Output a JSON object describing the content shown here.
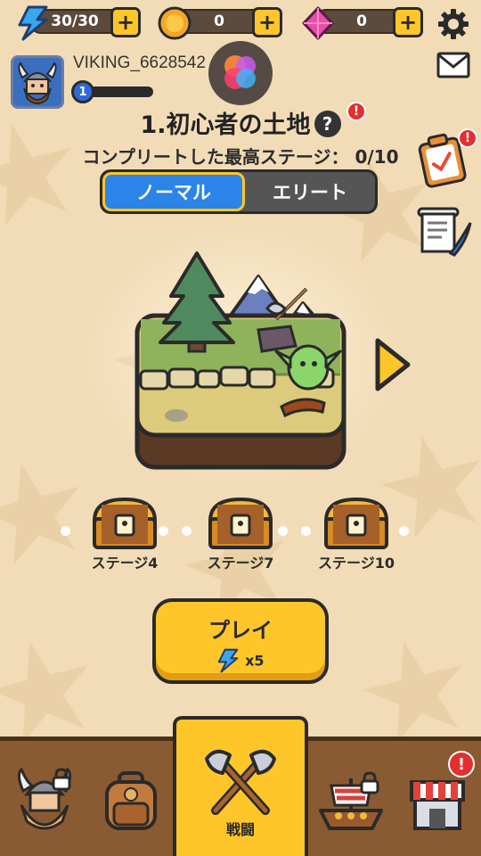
{
  "resources": {
    "energy": "30/30",
    "coins": "0",
    "gems": "0"
  },
  "profile": {
    "name": "VIKING_6628542",
    "level": "1"
  },
  "stage": {
    "title": "1.初心者の土地",
    "help": "?",
    "completed_text": "コンプリートした最高ステージ： 0/10"
  },
  "modes": {
    "normal": "ノーマル",
    "elite": "エリート"
  },
  "rewards": [
    {
      "label": "ステージ4"
    },
    {
      "label": "ステージ7"
    },
    {
      "label": "ステージ10"
    }
  ],
  "play": {
    "label": "プレイ",
    "cost": "x5"
  },
  "nav": {
    "battle": "戦闘"
  },
  "alert_symbol": "!",
  "plus_symbol": "+",
  "colors": {
    "accent_yellow": "#ffc62a",
    "mode_blue": "#2b84e8",
    "nav_brown": "#8a5a32",
    "alert_red": "#e52e2e"
  }
}
